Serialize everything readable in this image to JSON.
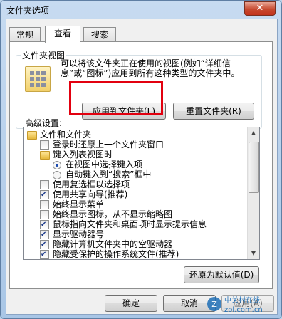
{
  "window": {
    "title": "文件夹选项",
    "close_glyph": "✕"
  },
  "tabs": [
    {
      "label": "常规"
    },
    {
      "label": "查看"
    },
    {
      "label": "搜索"
    }
  ],
  "folder_views": {
    "label": "文件夹视图",
    "description": "可以将该文件夹正在使用的视图(例如“详细信息”或“图标”)应用到所有这种类型的文件夹中。",
    "apply_button": "应用到文件夹(L)",
    "reset_button": "重置文件夹(R)"
  },
  "advanced": {
    "label": "高级设置:",
    "items": [
      {
        "text": "文件和文件夹",
        "kind": "folder",
        "indent": 0
      },
      {
        "text": "登录时还原上一个文件夹窗口",
        "kind": "checkbox",
        "checked": false,
        "indent": 1
      },
      {
        "text": "键入列表视图时",
        "kind": "folder",
        "indent": 1
      },
      {
        "text": "在视图中选择键入项",
        "kind": "radio",
        "checked": true,
        "indent": 2
      },
      {
        "text": "自动键入到“搜索”框中",
        "kind": "radio",
        "checked": false,
        "indent": 2
      },
      {
        "text": "使用复选框以选择项",
        "kind": "checkbox",
        "checked": false,
        "indent": 1
      },
      {
        "text": "使用共享向导(推荐)",
        "kind": "checkbox",
        "checked": true,
        "indent": 1
      },
      {
        "text": "始终显示菜单",
        "kind": "checkbox",
        "checked": false,
        "indent": 1
      },
      {
        "text": "始终显示图标，从不显示缩略图",
        "kind": "checkbox",
        "checked": false,
        "indent": 1
      },
      {
        "text": "鼠标指向文件夹和桌面项时显示提示信息",
        "kind": "checkbox",
        "checked": true,
        "indent": 1
      },
      {
        "text": "显示驱动器号",
        "kind": "checkbox",
        "checked": true,
        "indent": 1
      },
      {
        "text": "隐藏计算机文件夹中的空驱动器",
        "kind": "checkbox",
        "checked": true,
        "indent": 1
      },
      {
        "text": "隐藏受保护的操作系统文件(推荐)",
        "kind": "checkbox",
        "checked": true,
        "indent": 1
      }
    ],
    "restore_button": "还原为默认值(D)"
  },
  "footer": {
    "ok": "确定",
    "cancel": "取消",
    "apply": "应用(A)"
  },
  "watermark": {
    "brand": "中关村在线",
    "url": "zol.com.cn"
  }
}
